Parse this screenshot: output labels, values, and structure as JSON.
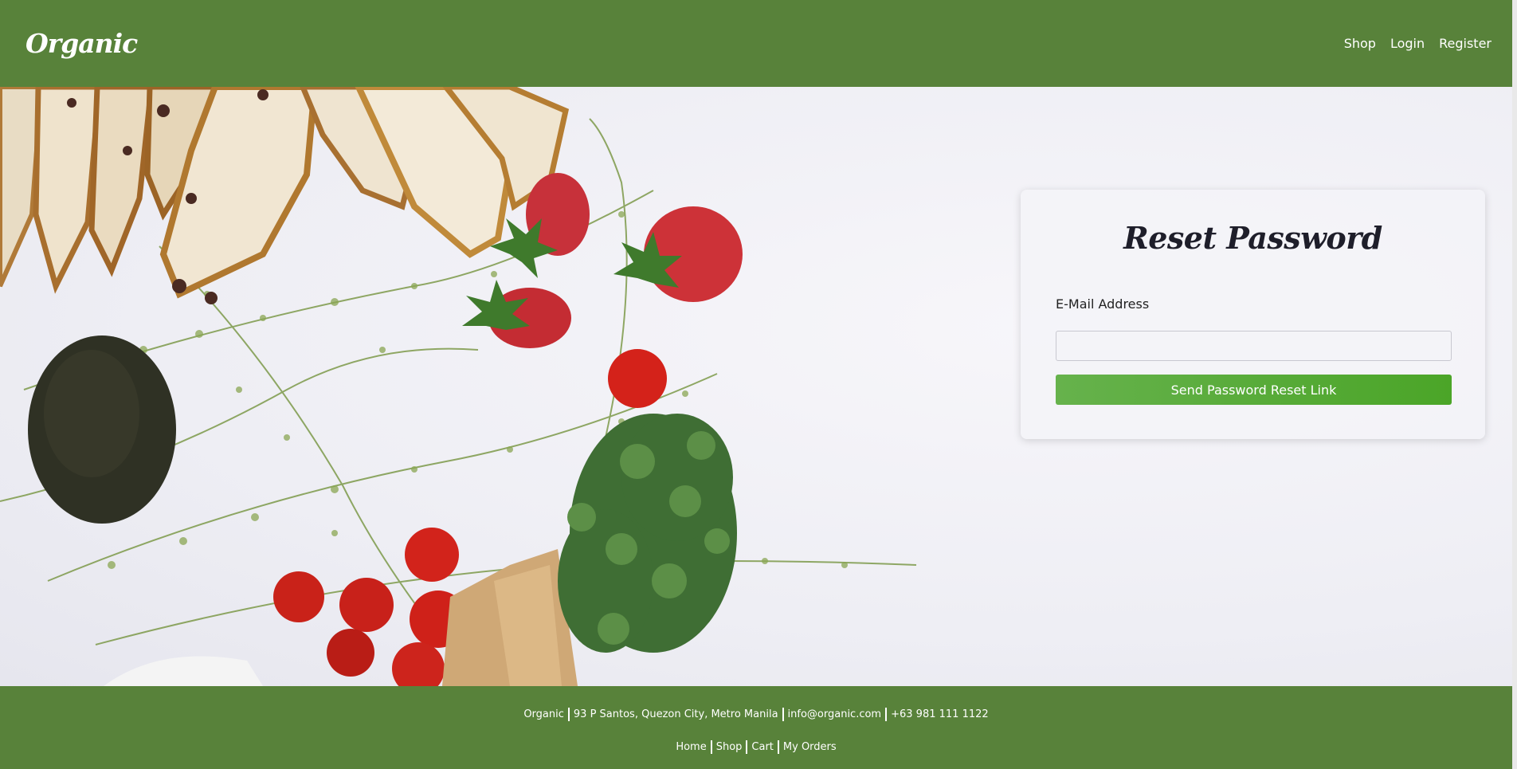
{
  "navbar": {
    "brand": "Organic",
    "links": [
      "Shop",
      "Login",
      "Register"
    ]
  },
  "card": {
    "title": "Reset Password",
    "email_label": "E-Mail Address",
    "email_value": "",
    "submit_label": "Send Password Reset Link"
  },
  "footer": {
    "info": [
      "Organic",
      "93 P Santos, Quezon City, Metro Manila",
      "info@organic.com",
      "+63 981 111 1122"
    ],
    "links": [
      "Home",
      "Shop",
      "Cart",
      "My Orders"
    ]
  },
  "colors": {
    "brand_green": "#58823a",
    "button_green": "#55ab35"
  }
}
